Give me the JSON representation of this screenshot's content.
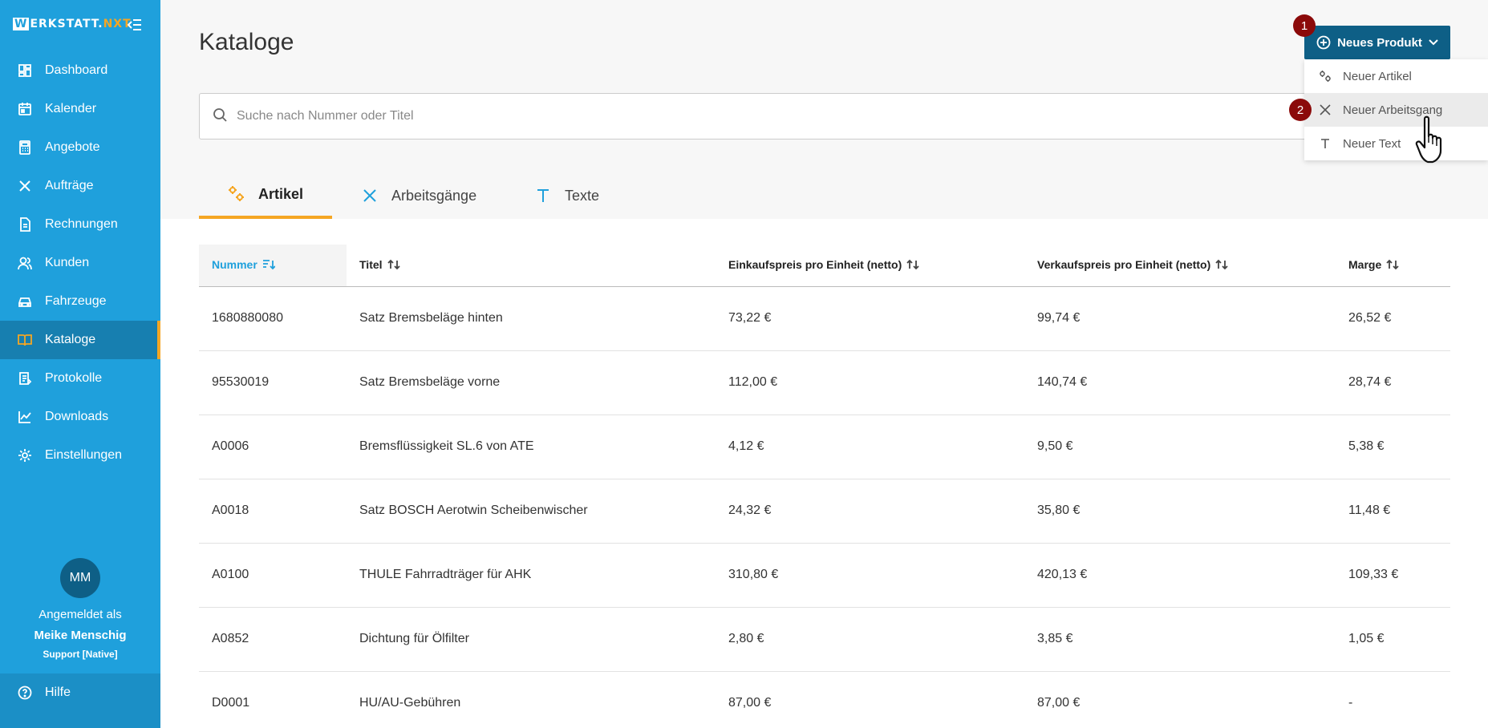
{
  "brand": {
    "w": "W",
    "rest": "ERKSTATT.",
    "nxt": "NXT"
  },
  "sidebar": {
    "items": [
      {
        "label": "Dashboard",
        "icon": "dashboard-icon"
      },
      {
        "label": "Kalender",
        "icon": "calendar-icon"
      },
      {
        "label": "Angebote",
        "icon": "calculator-icon"
      },
      {
        "label": "Aufträge",
        "icon": "tools-icon"
      },
      {
        "label": "Rechnungen",
        "icon": "invoice-icon"
      },
      {
        "label": "Kunden",
        "icon": "users-icon"
      },
      {
        "label": "Fahrzeuge",
        "icon": "car-icon"
      },
      {
        "label": "Kataloge",
        "icon": "book-icon",
        "active": true
      },
      {
        "label": "Protokolle",
        "icon": "clipboard-icon"
      },
      {
        "label": "Downloads",
        "icon": "chart-icon"
      },
      {
        "label": "Einstellungen",
        "icon": "gear-icon"
      }
    ],
    "user": {
      "initials": "MM",
      "logged_in_as": "Angemeldet als",
      "name": "Meike Menschig",
      "role": "Support [Native]"
    },
    "help": "Hilfe"
  },
  "page": {
    "title": "Kataloge"
  },
  "search": {
    "placeholder": "Suche nach Nummer oder Titel"
  },
  "tabs": [
    {
      "label": "Artikel",
      "active": true
    },
    {
      "label": "Arbeitsgänge"
    },
    {
      "label": "Texte"
    }
  ],
  "table": {
    "headers": [
      "Nummer",
      "Titel",
      "Einkaufspreis pro Einheit (netto)",
      "Verkaufspreis pro Einheit (netto)",
      "Marge"
    ],
    "rows": [
      [
        "1680880080",
        "Satz Bremsbeläge hinten",
        "73,22 €",
        "99,74 €",
        "26,52 €"
      ],
      [
        "95530019",
        "Satz Bremsbeläge vorne",
        "112,00 €",
        "140,74 €",
        "28,74 €"
      ],
      [
        "A0006",
        "Bremsflüssigkeit SL.6 von ATE",
        "4,12 €",
        "9,50 €",
        "5,38 €"
      ],
      [
        "A0018",
        "Satz BOSCH Aerotwin Scheibenwischer",
        "24,32 €",
        "35,80 €",
        "11,48 €"
      ],
      [
        "A0100",
        "THULE Fahrradträger für AHK",
        "310,80 €",
        "420,13 €",
        "109,33 €"
      ],
      [
        "A0852",
        "Dichtung für Ölfilter",
        "2,80 €",
        "3,85 €",
        "1,05 €"
      ],
      [
        "D0001",
        "HU/AU-Gebühren",
        "87,00 €",
        "87,00 €",
        "-"
      ]
    ]
  },
  "new_product": {
    "label": "Neues Produkt",
    "menu": [
      "Neuer Artikel",
      "Neuer Arbeitsgang",
      "Neuer Text"
    ]
  },
  "markers": [
    "1",
    "2"
  ],
  "colors": {
    "sidebar": "#1fa0dc",
    "sidebar_active": "#177fb0",
    "accent": "#f5a623",
    "button": "#0e5f86",
    "marker": "#8b0a0a"
  }
}
